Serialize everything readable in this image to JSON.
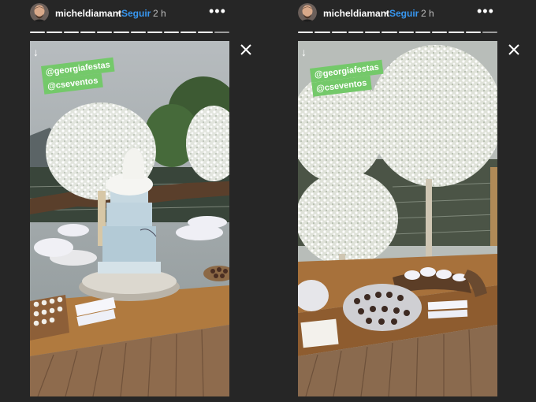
{
  "stories": [
    {
      "username": "micheldiamant",
      "separator": "•",
      "follow_label": "Seguir",
      "time_label": "2 h",
      "more_label": "•••",
      "down_arrow": "↓",
      "mentions": [
        "@georgiafestas",
        "@cseventos"
      ],
      "progress_total": 12,
      "progress_done": 11
    },
    {
      "username": "micheldiamant",
      "separator": "•",
      "follow_label": "Seguir",
      "time_label": "2 h",
      "more_label": "•••",
      "down_arrow": "↓",
      "mentions": [
        "@georgiafestas",
        "@cseventos"
      ],
      "progress_total": 12,
      "progress_done": 11
    }
  ],
  "colors": {
    "background": "#262626",
    "follow": "#3897f0",
    "tag": "#74c96a"
  },
  "icons": {
    "close": "close-icon",
    "more": "more-options-icon",
    "avatar": "avatar"
  }
}
